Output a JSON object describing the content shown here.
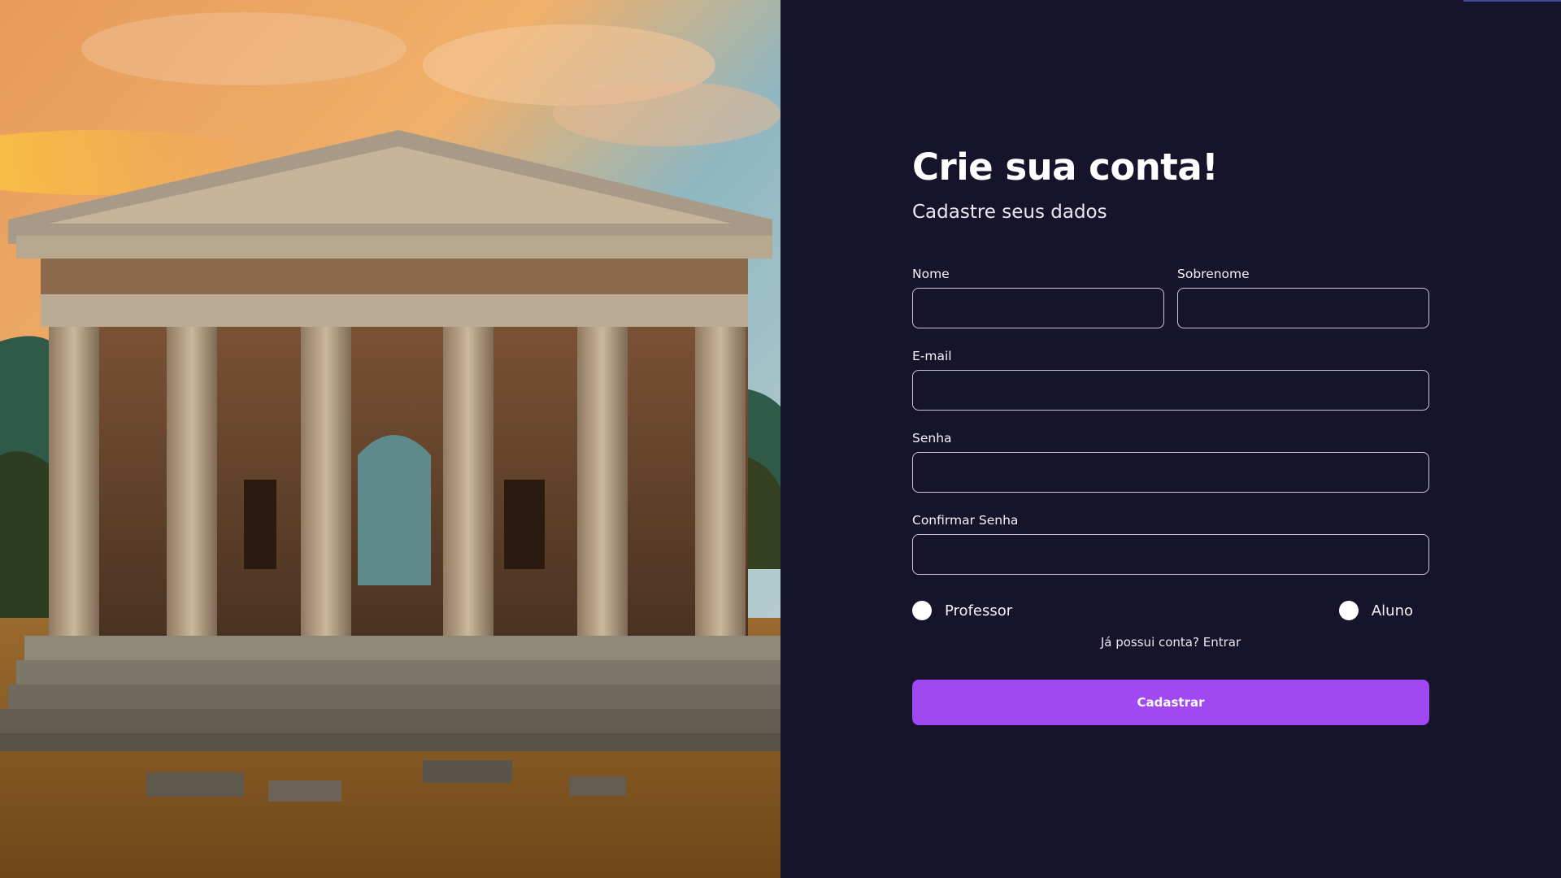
{
  "hero": {
    "image_name": "greek-temple-at-sunset-illustration"
  },
  "form": {
    "title": "Crie sua conta!",
    "subtitle": "Cadastre seus dados",
    "fields": {
      "first_name": {
        "label": "Nome",
        "value": "",
        "placeholder": ""
      },
      "last_name": {
        "label": "Sobrenome",
        "value": "",
        "placeholder": ""
      },
      "email": {
        "label": "E-mail",
        "value": "",
        "placeholder": ""
      },
      "password": {
        "label": "Senha",
        "value": "",
        "placeholder": ""
      },
      "confirm_password": {
        "label": "Confirmar Senha",
        "value": "",
        "placeholder": ""
      }
    },
    "roles": {
      "teacher": "Professor",
      "student": "Aluno"
    },
    "login_prompt": "Já possui conta?",
    "login_link": "Entrar",
    "submit_label": "Cadastrar"
  },
  "colors": {
    "panel_background": "#16142a",
    "accent": "#a048f2",
    "input_border": "#c9c7d6"
  }
}
